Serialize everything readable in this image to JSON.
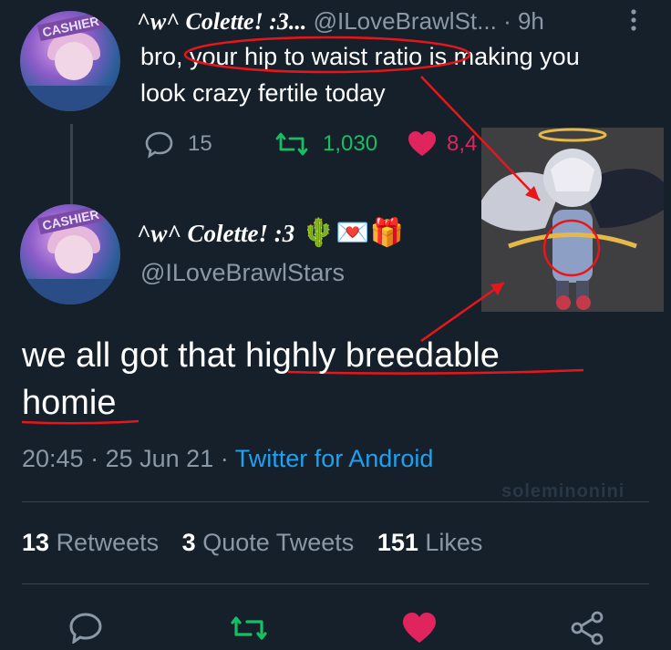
{
  "reply_tweet": {
    "avatar_sign": "CASHIER",
    "display_name": "^w^ Colette! :3...",
    "handle": "@ILoveBrawlSt...",
    "separator": "·",
    "time": "9h",
    "more_icon": "more-vertical-icon",
    "text_line1": "bro, your hip to waist ratio is making you",
    "text_line2": "look crazy fertile today",
    "reply_count": "15",
    "retweet_count": "1,030",
    "like_count": "8,4"
  },
  "main_tweet": {
    "avatar_sign": "CASHIER",
    "display_name": "^w^ Colette! :3",
    "emojis": "🌵💌🎁",
    "handle": "@ILoveBrawlStars",
    "text_line1": "we all got that highly breedable",
    "text_line2": "homie",
    "time": "20:45",
    "separator": "·",
    "date": "25 Jun 21",
    "source": "Twitter for Android",
    "watermark": "soleminonini"
  },
  "stats": {
    "retweets_count": "13",
    "retweets_label": "Retweets",
    "quote_count": "3",
    "quote_label": "Quote Tweets",
    "likes_count": "151",
    "likes_label": "Likes"
  },
  "actions": [
    "reply-icon",
    "retweet-icon",
    "like-icon",
    "share-icon"
  ],
  "colors": {
    "background": "#15202b",
    "retweet": "#17bf63",
    "like": "#e0245e",
    "link": "#1da1f2",
    "annotation": "#e8161b"
  }
}
